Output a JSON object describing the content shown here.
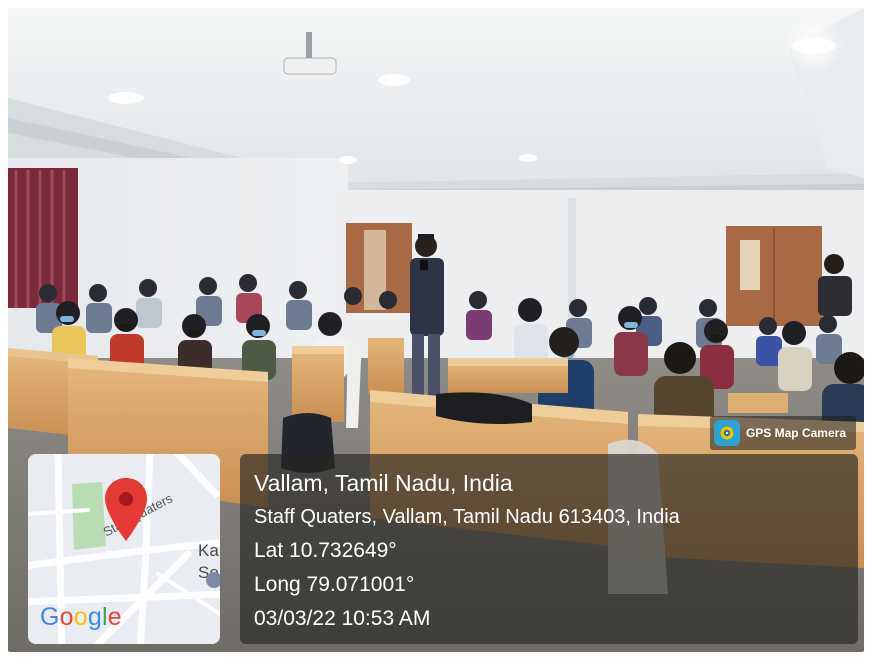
{
  "overlay": {
    "app_badge": "GPS Map Camera",
    "app_icon": "camera-icon",
    "location_title": "Vallam, Tamil Nadu, India",
    "address": "Staff Quaters, Vallam, Tamil Nadu 613403, India",
    "latitude": "Lat 10.732649°",
    "longitude": "Long 79.071001°",
    "datetime": "03/03/22 10:53 AM"
  },
  "map": {
    "street_label": "Staff Quaters",
    "partial_labels": [
      "Ka",
      "Se"
    ],
    "pin_icon": "map-pin-icon",
    "pin_color": "#e53935",
    "logo_letters": [
      {
        "ch": "G",
        "color": "#4285F4"
      },
      {
        "ch": "o",
        "color": "#EA4335"
      },
      {
        "ch": "o",
        "color": "#FBBC05"
      },
      {
        "ch": "g",
        "color": "#4285F4"
      },
      {
        "ch": "l",
        "color": "#34A853"
      },
      {
        "ch": "e",
        "color": "#EA4335"
      }
    ]
  },
  "colors": {
    "panel_bg": "#28261f",
    "wall": "#e8ebee",
    "desk": "#d9a86a",
    "door": "#a86a45",
    "curtain": "#7a2b3a"
  }
}
